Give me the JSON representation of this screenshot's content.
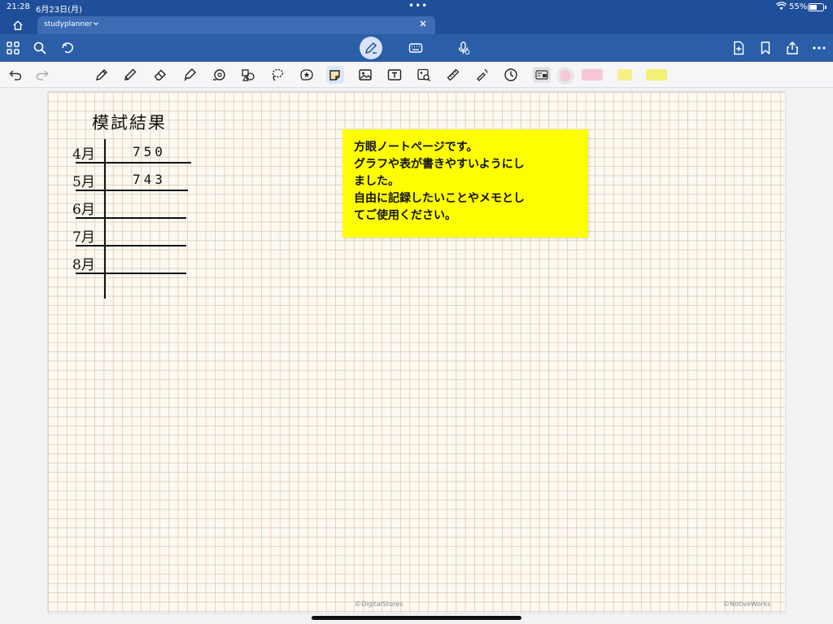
{
  "status_bar": {
    "time": "21:28",
    "date": "6月23日(月)",
    "battery": "55%"
  },
  "tab": {
    "label": "studyplanner"
  },
  "toolbar": {
    "icons": [
      "grid-icon",
      "search-icon",
      "lasso-sync-icon",
      "pen-mode-icon",
      "keyboard-icon",
      "mic-icon",
      "add-page-icon",
      "bookmark-icon",
      "share-icon",
      "more-icon"
    ]
  },
  "tools": {
    "icons": [
      "pen",
      "pencil",
      "eraser",
      "highlighter",
      "shape",
      "shapes",
      "lasso",
      "sticker",
      "sticky-note",
      "image",
      "text",
      "camera",
      "ruler",
      "laser-pointer",
      "history"
    ],
    "swatches": [
      "#f7c7d9",
      "#f5f08a",
      "#f3f176"
    ]
  },
  "page": {
    "title": "模試結果",
    "rows": [
      {
        "month": "4月",
        "score": "750"
      },
      {
        "month": "5月",
        "score": "743"
      },
      {
        "month": "6月",
        "score": ""
      },
      {
        "month": "7月",
        "score": ""
      },
      {
        "month": "8月",
        "score": ""
      }
    ],
    "sticky": {
      "line1": "方眼ノートページです。",
      "line2": "グラフや表が書きやすいようにし",
      "line3": "ました。",
      "line4": "自由に記録したいことやメモとし",
      "line5": "てご使用ください。"
    },
    "copyright_left": "©DigitalStores",
    "copyright_right": "©NotiveWorks"
  },
  "colors": {
    "nav": "#1f4f9a",
    "toolbar": "#2a5ea9",
    "sticky": "#fefe00"
  }
}
